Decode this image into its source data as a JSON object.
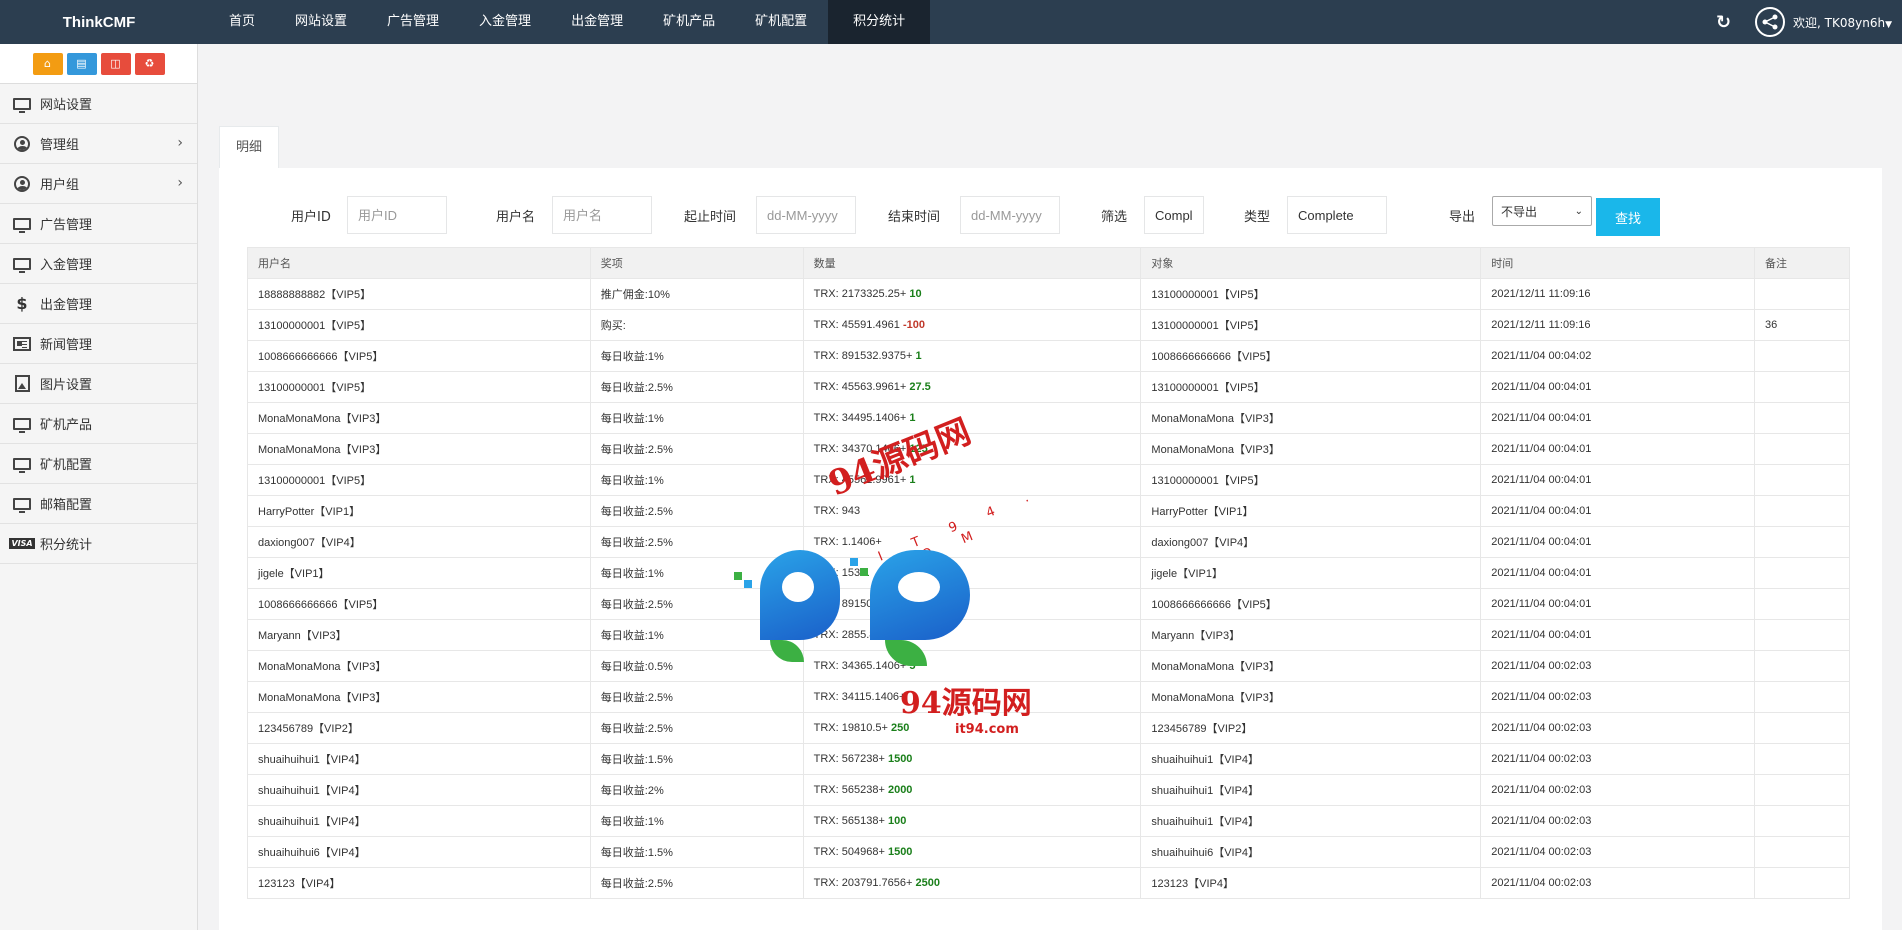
{
  "app": {
    "brand": "ThinkCMF"
  },
  "nav": [
    {
      "label": "首页"
    },
    {
      "label": "网站设置"
    },
    {
      "label": "广告管理"
    },
    {
      "label": "入金管理"
    },
    {
      "label": "出金管理"
    },
    {
      "label": "矿机产品"
    },
    {
      "label": "矿机配置"
    },
    {
      "label": "积分统计",
      "active": true
    }
  ],
  "header": {
    "welcome": "欢迎, TK08yn6h",
    "refresh_icon": "refresh-icon",
    "avatar_icon": "share-avatar-icon"
  },
  "shortcuts": [
    {
      "icon": "home-icon",
      "color": "#f39c12"
    },
    {
      "icon": "file-icon",
      "color": "#3498db"
    },
    {
      "icon": "trash-icon",
      "color": "#e74c3c"
    },
    {
      "icon": "recycle-icon",
      "color": "#e74c3c"
    }
  ],
  "sidebar": {
    "items": [
      {
        "label": "网站设置",
        "icon": "monitor-icon"
      },
      {
        "label": "管理组",
        "icon": "user-circle-icon",
        "has_children": true
      },
      {
        "label": "用户组",
        "icon": "user-circle-icon",
        "has_children": true
      },
      {
        "label": "广告管理",
        "icon": "monitor-icon"
      },
      {
        "label": "入金管理",
        "icon": "monitor-icon"
      },
      {
        "label": "出金管理",
        "icon": "dollar-icon"
      },
      {
        "label": "新闻管理",
        "icon": "newspaper-icon"
      },
      {
        "label": "图片设置",
        "icon": "picture-icon"
      },
      {
        "label": "矿机产品",
        "icon": "monitor-icon"
      },
      {
        "label": "矿机配置",
        "icon": "monitor-icon"
      },
      {
        "label": "邮箱配置",
        "icon": "monitor-icon"
      },
      {
        "label": "积分统计",
        "icon": "visa-icon"
      }
    ]
  },
  "tab": {
    "label": "明细"
  },
  "filter": {
    "user_id_label": "用户ID",
    "user_id_placeholder": "用户ID",
    "username_label": "用户名",
    "username_placeholder": "用户名",
    "start_label": "起止时间",
    "start_placeholder": "dd-MM-yyyy",
    "end_label": "结束时间",
    "end_placeholder": "dd-MM-yyyy",
    "screen_label": "筛选",
    "screen_value": "Complete",
    "type_label": "类型",
    "type_value": "Complete",
    "export_label": "导出",
    "export_value": "不导出",
    "search_label": "查找"
  },
  "table": {
    "headers": [
      "用户名",
      "奖项",
      "数量",
      "对象",
      "时间",
      "备注"
    ],
    "rows": [
      {
        "user": "18888888882【VIP5】",
        "award": "推广佣金:10%",
        "trx": "TRX: 2173325.25+",
        "delta": "10",
        "neg": false,
        "target": "13100000001【VIP5】",
        "time": "2021/12/11 11:09:16",
        "note": ""
      },
      {
        "user": "13100000001【VIP5】",
        "award": "购买:",
        "trx": "TRX: 45591.4961",
        "delta": "-100",
        "neg": true,
        "target": "13100000001【VIP5】",
        "time": "2021/12/11 11:09:16",
        "note": "36"
      },
      {
        "user": "1008666666666【VIP5】",
        "award": "每日收益:1%",
        "trx": "TRX: 891532.9375+",
        "delta": "1",
        "neg": false,
        "target": "1008666666666【VIP5】",
        "time": "2021/11/04 00:04:02",
        "note": ""
      },
      {
        "user": "13100000001【VIP5】",
        "award": "每日收益:2.5%",
        "trx": "TRX: 45563.9961+",
        "delta": "27.5",
        "neg": false,
        "target": "13100000001【VIP5】",
        "time": "2021/11/04 00:04:01",
        "note": ""
      },
      {
        "user": "MonaMonaMona【VIP3】",
        "award": "每日收益:1%",
        "trx": "TRX: 34495.1406+",
        "delta": "1",
        "neg": false,
        "target": "MonaMonaMona【VIP3】",
        "time": "2021/11/04 00:04:01",
        "note": ""
      },
      {
        "user": "MonaMonaMona【VIP3】",
        "award": "每日收益:2.5%",
        "trx": "TRX: 34370.1406+",
        "delta": "125",
        "neg": false,
        "target": "MonaMonaMona【VIP3】",
        "time": "2021/11/04 00:04:01",
        "note": ""
      },
      {
        "user": "13100000001【VIP5】",
        "award": "每日收益:1%",
        "trx": "TRX: 45562.9961+",
        "delta": "1",
        "neg": false,
        "target": "13100000001【VIP5】",
        "time": "2021/11/04 00:04:01",
        "note": ""
      },
      {
        "user": "HarryPotter【VIP1】",
        "award": "每日收益:2.5%",
        "trx": "TRX: 943",
        "delta": "",
        "neg": false,
        "target": "HarryPotter【VIP1】",
        "time": "2021/11/04 00:04:01",
        "note": ""
      },
      {
        "user": "daxiong007【VIP4】",
        "award": "每日收益:2.5%",
        "trx": "TRX: 1.1406+",
        "delta": "",
        "neg": false,
        "target": "daxiong007【VIP4】",
        "time": "2021/11/04 00:04:01",
        "note": ""
      },
      {
        "user": "jigele【VIP1】",
        "award": "每日收益:1%",
        "trx": "TRX: 153",
        "delta": "1",
        "neg": false,
        "target": "jigele【VIP1】",
        "time": "2021/11/04 00:04:01",
        "note": ""
      },
      {
        "user": "1008666666666【VIP5】",
        "award": "每日收益:2.5%",
        "trx": "TRX: 891507.9375+",
        "delta": "25",
        "neg": false,
        "target": "1008666666666【VIP5】",
        "time": "2021/11/04 00:04:01",
        "note": ""
      },
      {
        "user": "Maryann【VIP3】",
        "award": "每日收益:1%",
        "trx": "TRX: 2855.8774+",
        "delta": "1",
        "neg": false,
        "target": "Maryann【VIP3】",
        "time": "2021/11/04 00:04:01",
        "note": ""
      },
      {
        "user": "MonaMonaMona【VIP3】",
        "award": "每日收益:0.5%",
        "trx": "TRX: 34365.1406+",
        "delta": "5",
        "neg": false,
        "target": "MonaMonaMona【VIP3】",
        "time": "2021/11/04 00:02:03",
        "note": ""
      },
      {
        "user": "MonaMonaMona【VIP3】",
        "award": "每日收益:2.5%",
        "trx": "TRX: 34115.1406+",
        "delta": "",
        "neg": false,
        "target": "MonaMonaMona【VIP3】",
        "time": "2021/11/04 00:02:03",
        "note": ""
      },
      {
        "user": "123456789【VIP2】",
        "award": "每日收益:2.5%",
        "trx": "TRX: 19810.5+",
        "delta": "250",
        "neg": false,
        "target": "123456789【VIP2】",
        "time": "2021/11/04 00:02:03",
        "note": ""
      },
      {
        "user": "shuaihuihui1【VIP4】",
        "award": "每日收益:1.5%",
        "trx": "TRX: 567238+",
        "delta": "1500",
        "neg": false,
        "target": "shuaihuihui1【VIP4】",
        "time": "2021/11/04 00:02:03",
        "note": ""
      },
      {
        "user": "shuaihuihui1【VIP4】",
        "award": "每日收益:2%",
        "trx": "TRX: 565238+",
        "delta": "2000",
        "neg": false,
        "target": "shuaihuihui1【VIP4】",
        "time": "2021/11/04 00:02:03",
        "note": ""
      },
      {
        "user": "shuaihuihui1【VIP4】",
        "award": "每日收益:1%",
        "trx": "TRX: 565138+",
        "delta": "100",
        "neg": false,
        "target": "shuaihuihui1【VIP4】",
        "time": "2021/11/04 00:02:03",
        "note": ""
      },
      {
        "user": "shuaihuihui6【VIP4】",
        "award": "每日收益:1.5%",
        "trx": "TRX: 504968+",
        "delta": "1500",
        "neg": false,
        "target": "shuaihuihui6【VIP4】",
        "time": "2021/11/04 00:02:03",
        "note": ""
      },
      {
        "user": "123123【VIP4】",
        "award": "每日收益:2.5%",
        "trx": "TRX: 203791.7656+",
        "delta": "2500",
        "neg": false,
        "target": "123123【VIP4】",
        "time": "2021/11/04 00:02:03",
        "note": ""
      }
    ]
  },
  "watermark": {
    "top_text": "94源码网",
    "dots_text": "I T 9 4 . C O M",
    "bottom_text": "94源码网",
    "domain": "it94.com",
    "logo_icon": "p-logo-icon"
  }
}
